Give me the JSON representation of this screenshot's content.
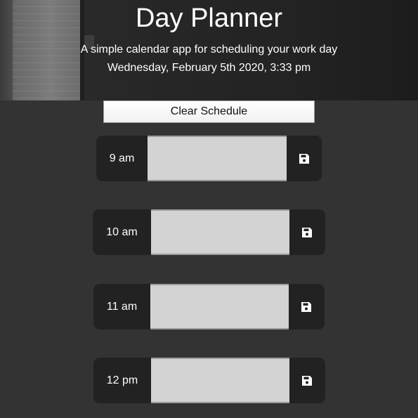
{
  "header": {
    "title": "Day Planner",
    "subtitle": "A simple calendar app for scheduling your work day",
    "datetime": "Wednesday, February 5th 2020, 3:33 pm"
  },
  "actions": {
    "clear_label": "Clear Schedule"
  },
  "schedule": [
    {
      "hour": "9 am",
      "note": ""
    },
    {
      "hour": "10 am",
      "note": ""
    },
    {
      "hour": "11 am",
      "note": ""
    },
    {
      "hour": "12 pm",
      "note": ""
    }
  ],
  "icons": {
    "save": "floppy-disk-icon"
  },
  "colors": {
    "background": "#333333",
    "row_background": "#222222",
    "textarea_background": "#d3d3d3",
    "text": "#ffffff"
  }
}
